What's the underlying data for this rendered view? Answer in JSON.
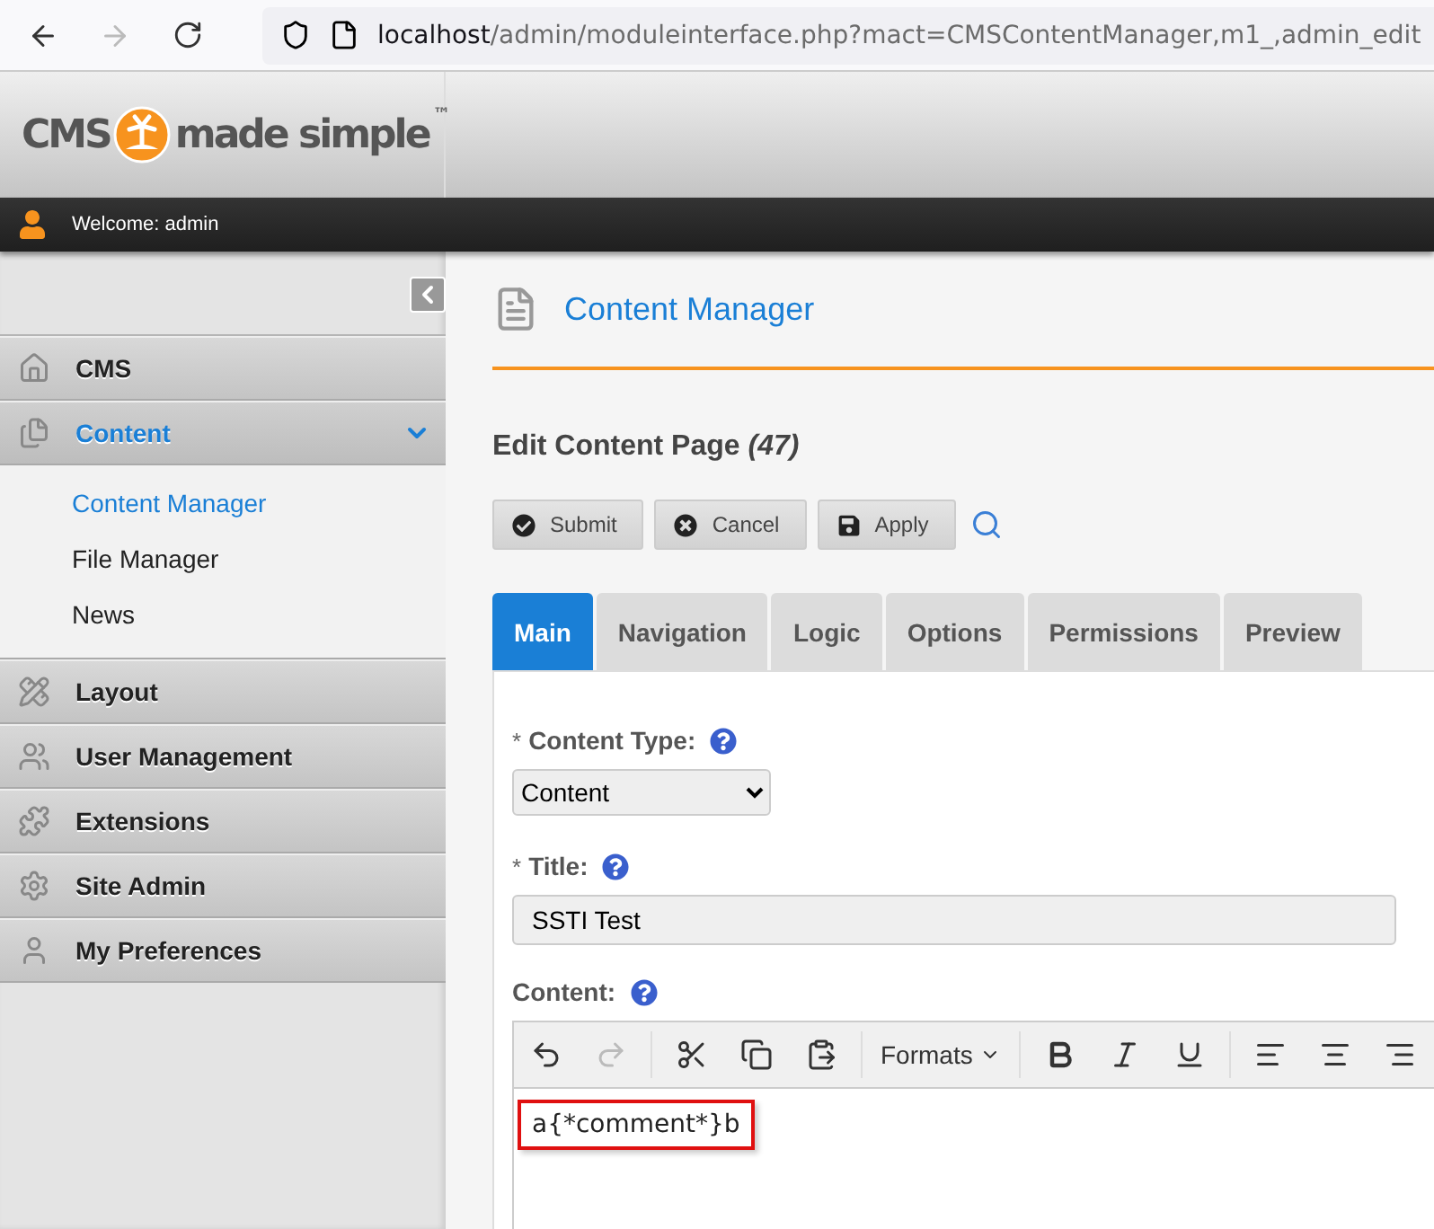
{
  "browser": {
    "url_host": "localhost",
    "url_path": "/admin/moduleinterface.php?mact=CMSContentManager,m1_,admin_edit",
    "back_disabled": false,
    "forward_disabled": true
  },
  "header": {
    "logo_left": "CMS",
    "logo_right": "made simple",
    "logo_mark": "™",
    "welcome": "Welcome: admin"
  },
  "sidebar": {
    "items": [
      {
        "label": "CMS",
        "selected": false,
        "expanded": false
      },
      {
        "label": "Content",
        "selected": true,
        "expanded": true,
        "children": [
          {
            "label": "Content Manager",
            "selected": true
          },
          {
            "label": "File Manager",
            "selected": false
          },
          {
            "label": "News",
            "selected": false
          }
        ]
      },
      {
        "label": "Layout",
        "selected": false,
        "expanded": false
      },
      {
        "label": "User Management",
        "selected": false,
        "expanded": false
      },
      {
        "label": "Extensions",
        "selected": false,
        "expanded": false
      },
      {
        "label": "Site Admin",
        "selected": false,
        "expanded": false
      },
      {
        "label": "My Preferences",
        "selected": false,
        "expanded": false
      }
    ]
  },
  "page": {
    "module_title": "Content Manager",
    "heading": "Edit Content Page *(47)*",
    "buttons": [
      {
        "label": "Submit",
        "kind": "submit"
      },
      {
        "label": "Cancel",
        "kind": "cancel"
      },
      {
        "label": "Apply",
        "kind": "apply"
      }
    ],
    "tabs": [
      {
        "label": "Main",
        "selected": true
      },
      {
        "label": "Navigation",
        "selected": false
      },
      {
        "label": "Logic",
        "selected": false
      },
      {
        "label": "Options",
        "selected": false
      },
      {
        "label": "Permissions",
        "selected": false
      },
      {
        "label": "Preview",
        "selected": false
      }
    ],
    "fields": [
      {
        "kind": "select",
        "marker": "*",
        "label": "Content Type:",
        "value": "Content"
      },
      {
        "kind": "text",
        "marker": "*",
        "label": "Title:",
        "value": "SSTI Test"
      },
      {
        "kind": "editor",
        "label": "Content:",
        "toolbar_formats": "Formats",
        "value": "a{*comment*}b"
      }
    ]
  }
}
